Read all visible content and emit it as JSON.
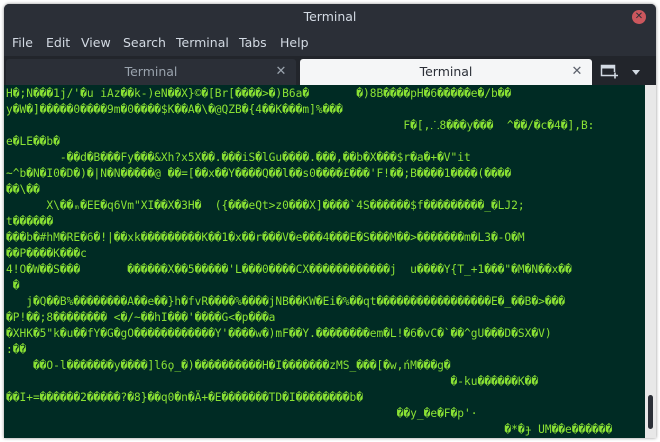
{
  "window": {
    "title": "Terminal"
  },
  "menubar": {
    "items": [
      "File",
      "Edit",
      "View",
      "Search",
      "Terminal",
      "Tabs",
      "Help"
    ]
  },
  "tabs": [
    {
      "label": "Terminal",
      "active": false
    },
    {
      "label": "Terminal",
      "active": true
    }
  ],
  "icons": {
    "close": "close-icon",
    "tab_close": "close-icon",
    "new_tab": "new-tab-icon",
    "tabs_menu": "chevron-down-icon"
  },
  "colors": {
    "terminal_bg": "#002b24",
    "terminal_fg": "#8ae234",
    "close_button": "#cc575d"
  },
  "terminal": {
    "lines": [
      "H�;N���1j/'�u iAz��k-)eN��X}©�[Br[����>�)B6a�       �)8B����pH�6�����e�/b��",
      "y�W�]�����0����9m�0����$K��A�\\�@QZB�{4��K���m]%���",
      "                                                           F�[,⸫8���y���  ^��/�c�4�],B:",
      "e�LE��b�",
      "        -��d�B���Fy���&Xh?x5X��.���iS�lGu����.���,��b�X���$r�a�+�V\"it",
      "~^b�N�I0�D�)�|N�N�����@ ��=[��x��Y����Q��l��s0����£���'F!��;B����1����(����",
      "��\\��",
      "      X\\��ₘ�EE�q6Vm\"XI��X�3H�  ({���eQt>z0���X]����`4S������$f���������_�LJ2;",
      "t������",
      "���b�#hM�RE�6�!|��xk���������K��1�x��r���V�e���4���E�S���M��>�������m�L3�-O�M",
      "��P����K���c",
      "4!O�W��S���       ������X��5�����'L���0����CX������������j  u����Y{T_+1���\"�M�N��x��",
      " �",
      "   j�Q��B%��������A��e��}h�fvR����%����jNB��KW�Ei�%��qt�����������������E�_��B�>���",
      "�P!��;8�������� <�/~��hI���'����G<�p���a",
      "�XHK�5\"k�u��fY�G�gO������������Y'����w�)mF��Y.��������em�L!�6�vC�`��^gU���D�SX�V)",
      ":��",
      "    ��O-l�������y����]l6ϙ_�)����������H�I�������zMS_���[�w,ńM���g�",
      "                                                                  �-ku������K��",
      "��I+=������2�����?�8}��q0�n�Ä+�E�������TD�I��������b�",
      "                                                          ��y_�e�F�p'·",
      "                                                                          �*�ɟ UM��e������"
    ]
  }
}
